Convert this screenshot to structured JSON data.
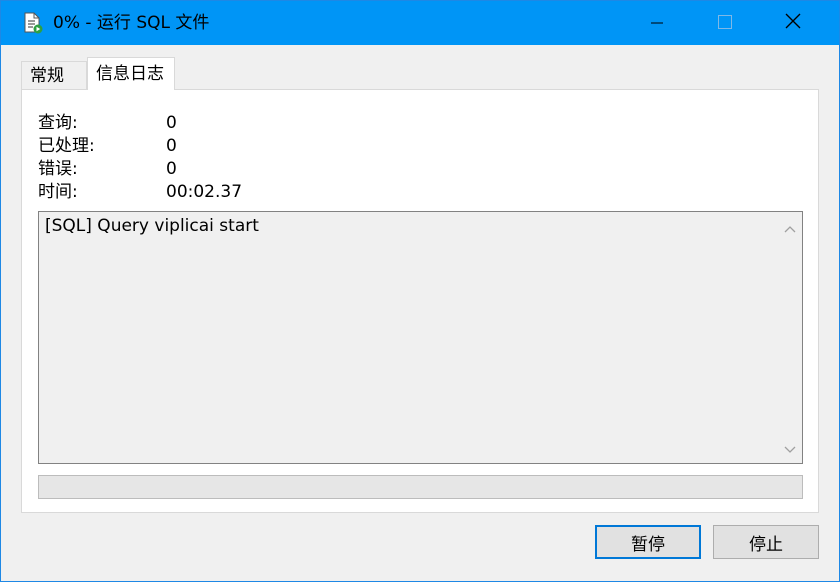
{
  "window": {
    "title": "0% - 运行 SQL 文件",
    "icons": [
      "document-run-icon",
      "minimize-icon",
      "maximize-icon",
      "close-icon"
    ]
  },
  "tabs": [
    {
      "label": "常规",
      "selected": false
    },
    {
      "label": "信息日志",
      "selected": true
    }
  ],
  "stats": [
    {
      "label": "查询:",
      "value": "0"
    },
    {
      "label": "已处理:",
      "value": "0"
    },
    {
      "label": "错误:",
      "value": "0"
    },
    {
      "label": "时间:",
      "value": "00:02.37"
    }
  ],
  "log": {
    "lines": [
      "[SQL] Query viplicai start"
    ]
  },
  "progress": {
    "fraction": 0
  },
  "buttons": {
    "pause_label": "暂停",
    "stop_label": "停止"
  },
  "colors": {
    "titlebar": "#0095f6",
    "focus_border": "#0078d7"
  }
}
